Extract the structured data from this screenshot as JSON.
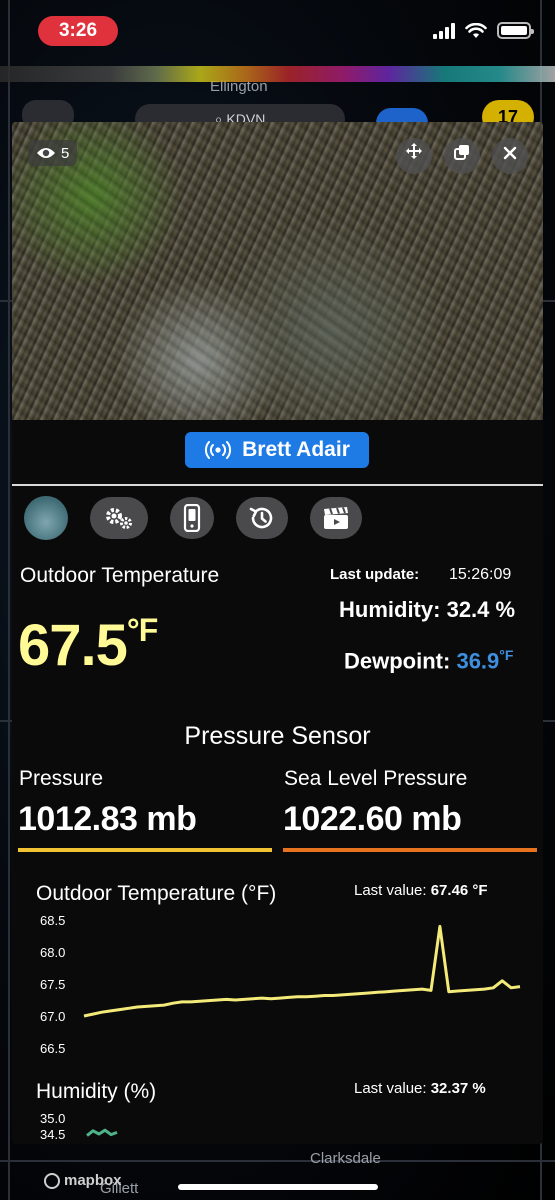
{
  "status_bar": {
    "time": "3:26"
  },
  "map": {
    "labels": [
      "Ellington",
      "Clarksdale",
      "Gillett"
    ],
    "search_text": "KDVN",
    "badge": "17",
    "attribution": "mapbox"
  },
  "video": {
    "viewer_count": "5",
    "streamer_name": "Brett Adair"
  },
  "weather": {
    "outdoor_temp_label": "Outdoor Temperature",
    "outdoor_temp_value": "67.5",
    "outdoor_temp_unit": "°F",
    "last_update_label": "Last update:",
    "last_update_value": "15:26:09",
    "humidity_label": "Humidity:",
    "humidity_value": "32.4 %",
    "dewpoint_label": "Dewpoint:",
    "dewpoint_value": "36.9",
    "dewpoint_unit": "°F"
  },
  "pressure": {
    "section_title": "Pressure Sensor",
    "pressure_label": "Pressure",
    "pressure_value": "1012.83",
    "pressure_unit": "mb",
    "sea_level_label": "Sea Level Pressure",
    "sea_level_value": "1022.60",
    "sea_level_unit": "mb"
  },
  "colors": {
    "pressure_bar": "#f1c232",
    "sea_level_bar": "#e8731e",
    "temp_line": "#f3ea7a",
    "humidity_line": "#4fb38a",
    "dewpoint_value": "#3e8fe0"
  },
  "chart_data": [
    {
      "type": "line",
      "title": "Outdoor Temperature (°F)",
      "last_value_label": "Last value:",
      "last_value": "67.46 °F",
      "yticks": [
        "68.5",
        "68.0",
        "67.5",
        "67.0",
        "66.5"
      ],
      "ylim": [
        66.5,
        68.5
      ],
      "x": [
        0,
        1,
        2,
        3,
        4,
        5,
        6,
        7,
        8,
        9,
        10,
        11,
        12,
        13,
        14,
        15,
        16,
        17,
        18,
        19,
        20,
        21,
        22,
        23,
        24,
        25,
        26,
        27,
        28,
        29,
        30,
        31,
        32,
        33,
        34,
        35,
        36,
        37,
        38,
        39,
        40,
        41,
        42,
        43,
        44,
        45,
        46,
        47,
        48,
        49
      ],
      "series": [
        {
          "values": [
            67.0,
            67.03,
            67.06,
            67.08,
            67.1,
            67.12,
            67.14,
            67.15,
            67.16,
            67.17,
            67.2,
            67.22,
            67.22,
            67.23,
            67.24,
            67.25,
            67.26,
            67.25,
            67.26,
            67.27,
            67.28,
            67.27,
            67.28,
            67.29,
            67.3,
            67.3,
            67.31,
            67.32,
            67.32,
            67.33,
            67.34,
            67.35,
            67.36,
            67.37,
            67.38,
            67.39,
            67.4,
            67.41,
            67.42,
            67.4,
            68.4,
            67.38,
            67.39,
            67.4,
            67.41,
            67.42,
            67.44,
            67.55,
            67.44,
            67.46
          ]
        }
      ]
    },
    {
      "type": "line",
      "title": "Humidity (%)",
      "last_value_label": "Last value:",
      "last_value": "32.37 %",
      "yticks": [
        "35.0",
        "34.5"
      ],
      "ylim": [
        34.5,
        35.0
      ],
      "x": [
        0,
        1,
        2,
        3,
        4,
        5
      ],
      "series": [
        {
          "values": [
            34.45,
            34.6,
            34.5,
            34.62,
            34.48,
            34.55
          ]
        }
      ]
    }
  ]
}
